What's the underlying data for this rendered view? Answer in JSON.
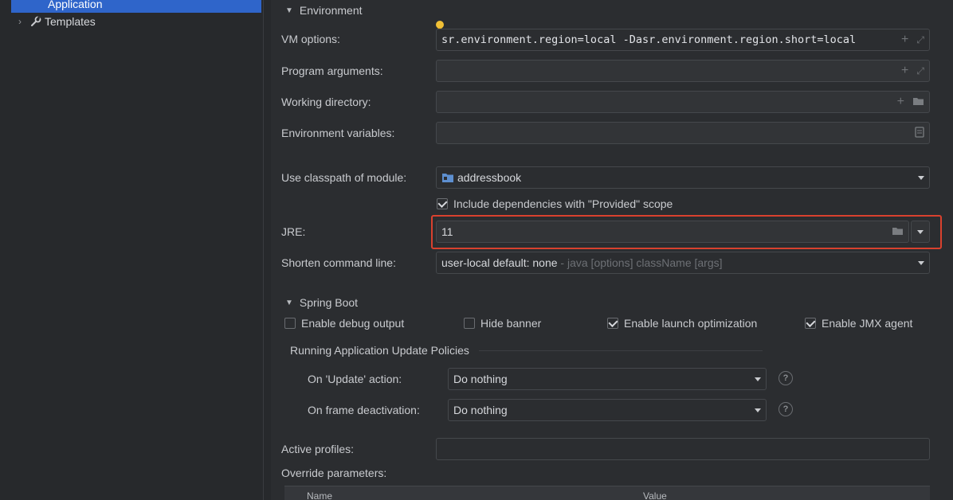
{
  "sidebar": {
    "items": [
      {
        "label": "Application",
        "selected": true
      },
      {
        "label": "Templates",
        "icon": "wrench-icon"
      }
    ]
  },
  "environment": {
    "title": "Environment",
    "vm_options": {
      "label": "VM options:",
      "value": "sr.environment.region=local -Dasr.environment.region.short=local"
    },
    "program_arguments": {
      "label": "Program arguments:",
      "value": ""
    },
    "working_directory": {
      "label": "Working directory:",
      "value": ""
    },
    "environment_variables": {
      "label": "Environment variables:",
      "value": ""
    },
    "classpath_module": {
      "label": "Use classpath of module:",
      "value": "addressbook",
      "icon": "module-folder-icon"
    },
    "include_provided": {
      "label": "Include dependencies with \"Provided\" scope",
      "checked": true
    },
    "jre": {
      "label": "JRE:",
      "value": "11"
    },
    "shorten_command_line": {
      "label": "Shorten command line:",
      "value": "user-local default: none",
      "hint": " - java [options] className [args]"
    }
  },
  "spring_boot": {
    "title": "Spring Boot",
    "checkboxes": [
      {
        "label": "Enable debug output",
        "checked": false
      },
      {
        "label": "Hide banner",
        "checked": false
      },
      {
        "label": "Enable launch optimization",
        "checked": true
      },
      {
        "label": "Enable JMX agent",
        "checked": true
      }
    ],
    "update_policies_title": "Running Application Update Policies",
    "on_update": {
      "label": "On 'Update' action:",
      "value": "Do nothing"
    },
    "on_frame_deactivation": {
      "label": "On frame deactivation:",
      "value": "Do nothing"
    },
    "active_profiles": {
      "label": "Active profiles:",
      "value": ""
    },
    "override_parameters": {
      "label": "Override parameters:",
      "columns": [
        "Name",
        "Value"
      ]
    }
  },
  "colors": {
    "accent_selection": "#2f65ca",
    "highlight_border": "#d9412e",
    "background": "#2b2d30"
  }
}
